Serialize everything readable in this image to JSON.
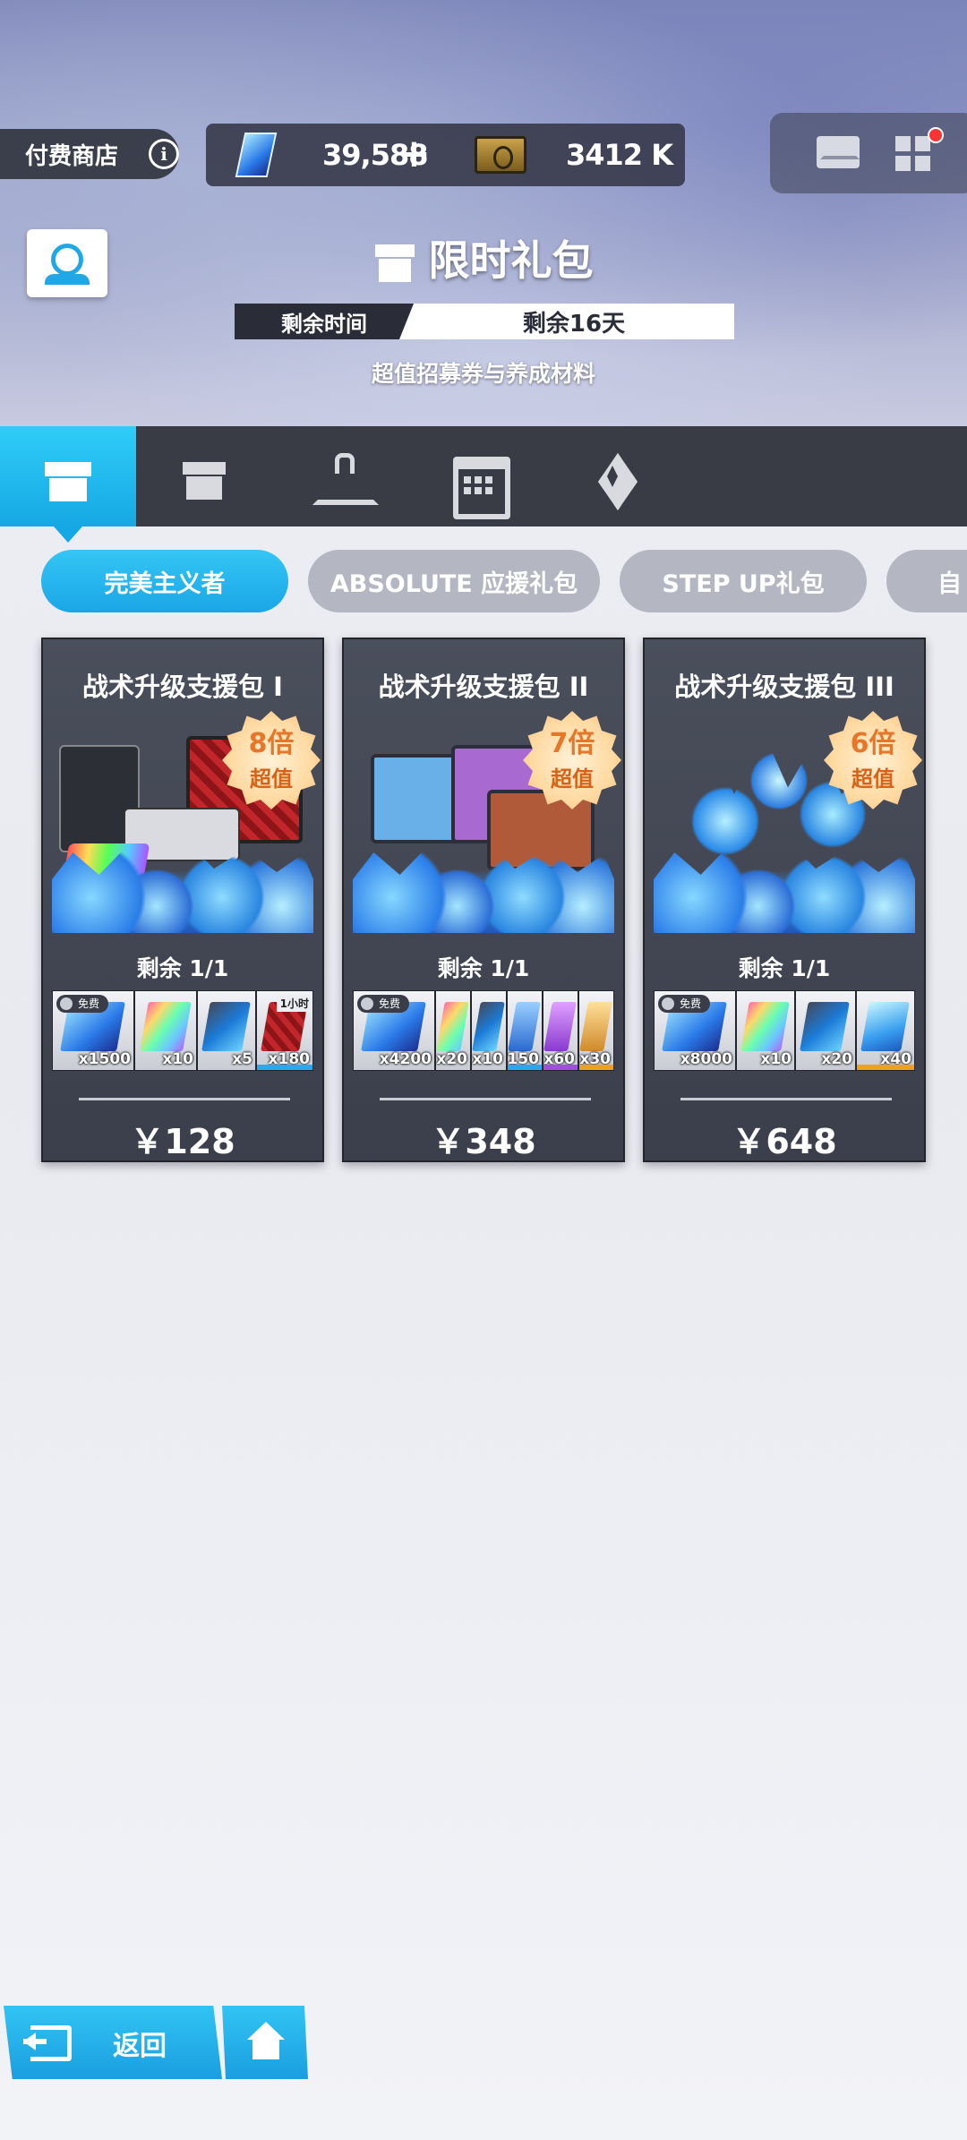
{
  "header": {
    "shop_label": "付费商店",
    "gems": "39,588",
    "gems_plus": "+",
    "tickets": "3412 K"
  },
  "banner": {
    "title": "限时礼包",
    "time_label": "剩余时间",
    "time_value": "剩余16天",
    "subtitle": "超值招募券与养成材料"
  },
  "tabs": [
    {
      "icon": "gift-hourglass-icon",
      "active": true
    },
    {
      "icon": "gift-icon",
      "active": false
    },
    {
      "icon": "hanger-icon",
      "active": false
    },
    {
      "icon": "calendar-icon",
      "active": false
    },
    {
      "icon": "diamond-emblem-icon",
      "active": false
    }
  ],
  "subtabs": [
    "完美主义者",
    "ABSOLUTE  应援礼包",
    "STEP UP礼包",
    "自"
  ],
  "cards": [
    {
      "title": "战术升级支援包 I",
      "badge_value": "8倍",
      "badge_label": "超值",
      "remaining": "剩余  1/1",
      "price": "￥128",
      "items": [
        {
          "qty": "x1500",
          "free": "免费"
        },
        {
          "qty": "x10"
        },
        {
          "qty": "x5"
        },
        {
          "qty": "x180",
          "tag": "1小时"
        }
      ]
    },
    {
      "title": "战术升级支援包 II",
      "badge_value": "7倍",
      "badge_label": "超值",
      "remaining": "剩余  1/1",
      "price": "￥348",
      "items": [
        {
          "qty": "x4200",
          "free": "免费"
        },
        {
          "qty": "x20"
        },
        {
          "qty": "x10"
        },
        {
          "qty": "x150"
        },
        {
          "qty": "x60"
        },
        {
          "qty": "x30"
        }
      ]
    },
    {
      "title": "战术升级支援包 III",
      "badge_value": "6倍",
      "badge_label": "超值",
      "remaining": "剩余  1/1",
      "price": "￥648",
      "items": [
        {
          "qty": "x8000",
          "free": "免费"
        },
        {
          "qty": "x10"
        },
        {
          "qty": "x20"
        },
        {
          "qty": "x40"
        }
      ]
    }
  ],
  "footer": {
    "back_label": "返回"
  },
  "colors": {
    "accent": "#1fb3ec",
    "card_bg": "#434754",
    "badge_text": "#e6762a"
  }
}
